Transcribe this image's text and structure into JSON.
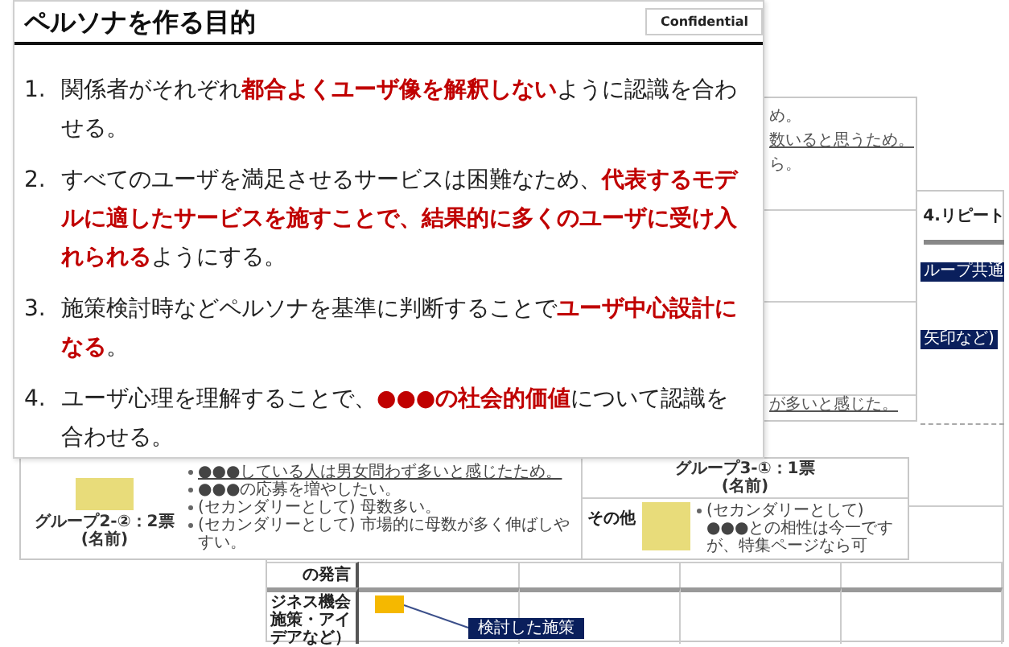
{
  "main_slide": {
    "title": "ペルソナを作る目的",
    "badge": "Confidential",
    "items": [
      {
        "number": "1.",
        "text": "関係者がそれぞれ**都合よくユーザ像を解釈しない**ように認識を合わせる。"
      },
      {
        "number": "2.",
        "text": "すべてのユーザを満足させるサービスは困難なため、**代表するモデルに適したサービスを施すことで、結果的に多くのユーザに受け入れられる**ようにする。"
      },
      {
        "number": "3.",
        "text": "施策検討時などペルソナを基準に判断することで**ユーザ中心設計になる**。"
      },
      {
        "number": "4.",
        "text": "ユーザ心理を理解することで、**●●●の社会的価値**について認識を合わせる。"
      }
    ]
  },
  "group_slide": {
    "group_a": {
      "name": "グループ2-②：2票",
      "caption": "(名前)",
      "bullets": [
        {
          "text": "●●●している人は男女問わず多いと感じたため。",
          "underlined": true
        },
        {
          "text": "●●●の応募を増やしたい。",
          "underlined": false
        },
        {
          "text": "(セカンダリーとして) 母数多い。",
          "underlined": false
        },
        {
          "text": "(セカンダリーとして) 市場的に母数が多く伸ばしやすい。",
          "underlined": false
        }
      ]
    },
    "group_b": {
      "name": "グループ3-①：1票",
      "caption": "(名前)"
    },
    "other": {
      "label": "その他",
      "bullets": [
        {
          "text": "(セカンダリーとして) ●●●との相性は今一ですが、特集ページなら可",
          "underlined": false
        }
      ]
    }
  },
  "notes_slide": {
    "top_lines": [
      {
        "text": "め。",
        "underlined": false
      },
      {
        "text": "数いると思うため。",
        "underlined": true
      },
      {
        "text": "ら。",
        "underlined": false
      }
    ],
    "bottom_line": {
      "text": "が多いと感じた。",
      "underlined": true
    }
  },
  "table_slide": {
    "column_header": "4.リピート",
    "bars": [
      "ループ共通",
      "矢印など)"
    ],
    "row_labels": [
      "の発言",
      "ジネス機会施策・アイデアなど）"
    ],
    "callout": "検討した施策"
  }
}
